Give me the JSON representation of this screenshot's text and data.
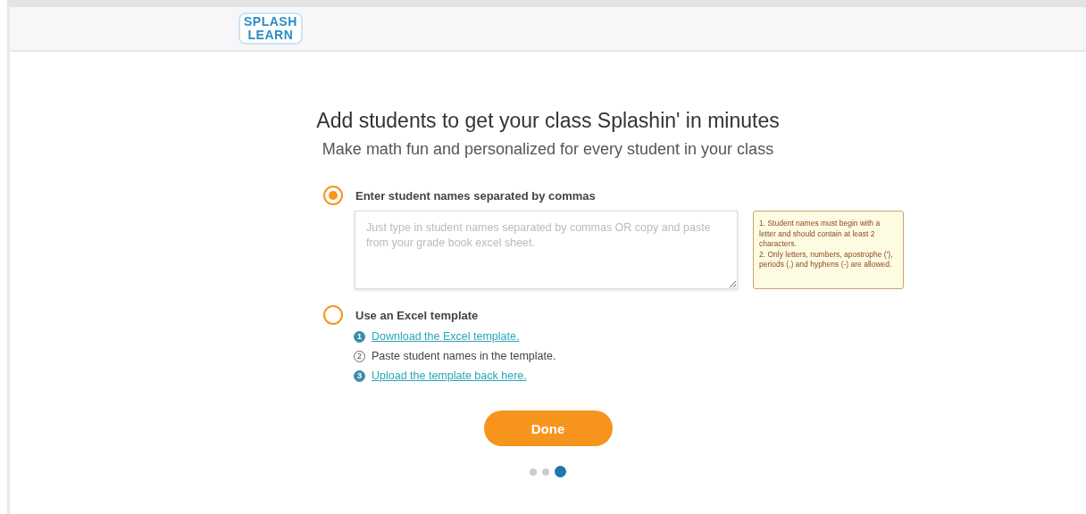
{
  "header": {
    "logo": [
      "SPLASH",
      "LEARN"
    ]
  },
  "title": "Add students to get your class Splashin' in minutes",
  "subtitle": "Make math fun and personalized for every student in your class",
  "options": [
    {
      "label": "Enter student names separated by commas",
      "selected": true,
      "kind": "textarea",
      "placeholder": "Just type in student names separated by commas OR copy and paste from your grade book excel sheet.",
      "tooltip": [
        "1. Student names must begin with a letter and should contain at least 2 characters.",
        "2. Only letters, numbers, apostrophe ('), periods (.) and hyphens (-) are allowed."
      ]
    },
    {
      "label": "Use an Excel template",
      "selected": false,
      "kind": "steps",
      "steps": [
        {
          "number": "1",
          "text": "Download the Excel template.",
          "kind": "link"
        },
        {
          "number": "2",
          "text": "Paste student names in the template.",
          "kind": "text"
        },
        {
          "number": "3",
          "text": "Upload the template back here.",
          "kind": "link"
        }
      ]
    }
  ],
  "done_button": "Done",
  "pager": [
    {
      "selected": false
    },
    {
      "selected": false
    },
    {
      "selected": true
    }
  ]
}
